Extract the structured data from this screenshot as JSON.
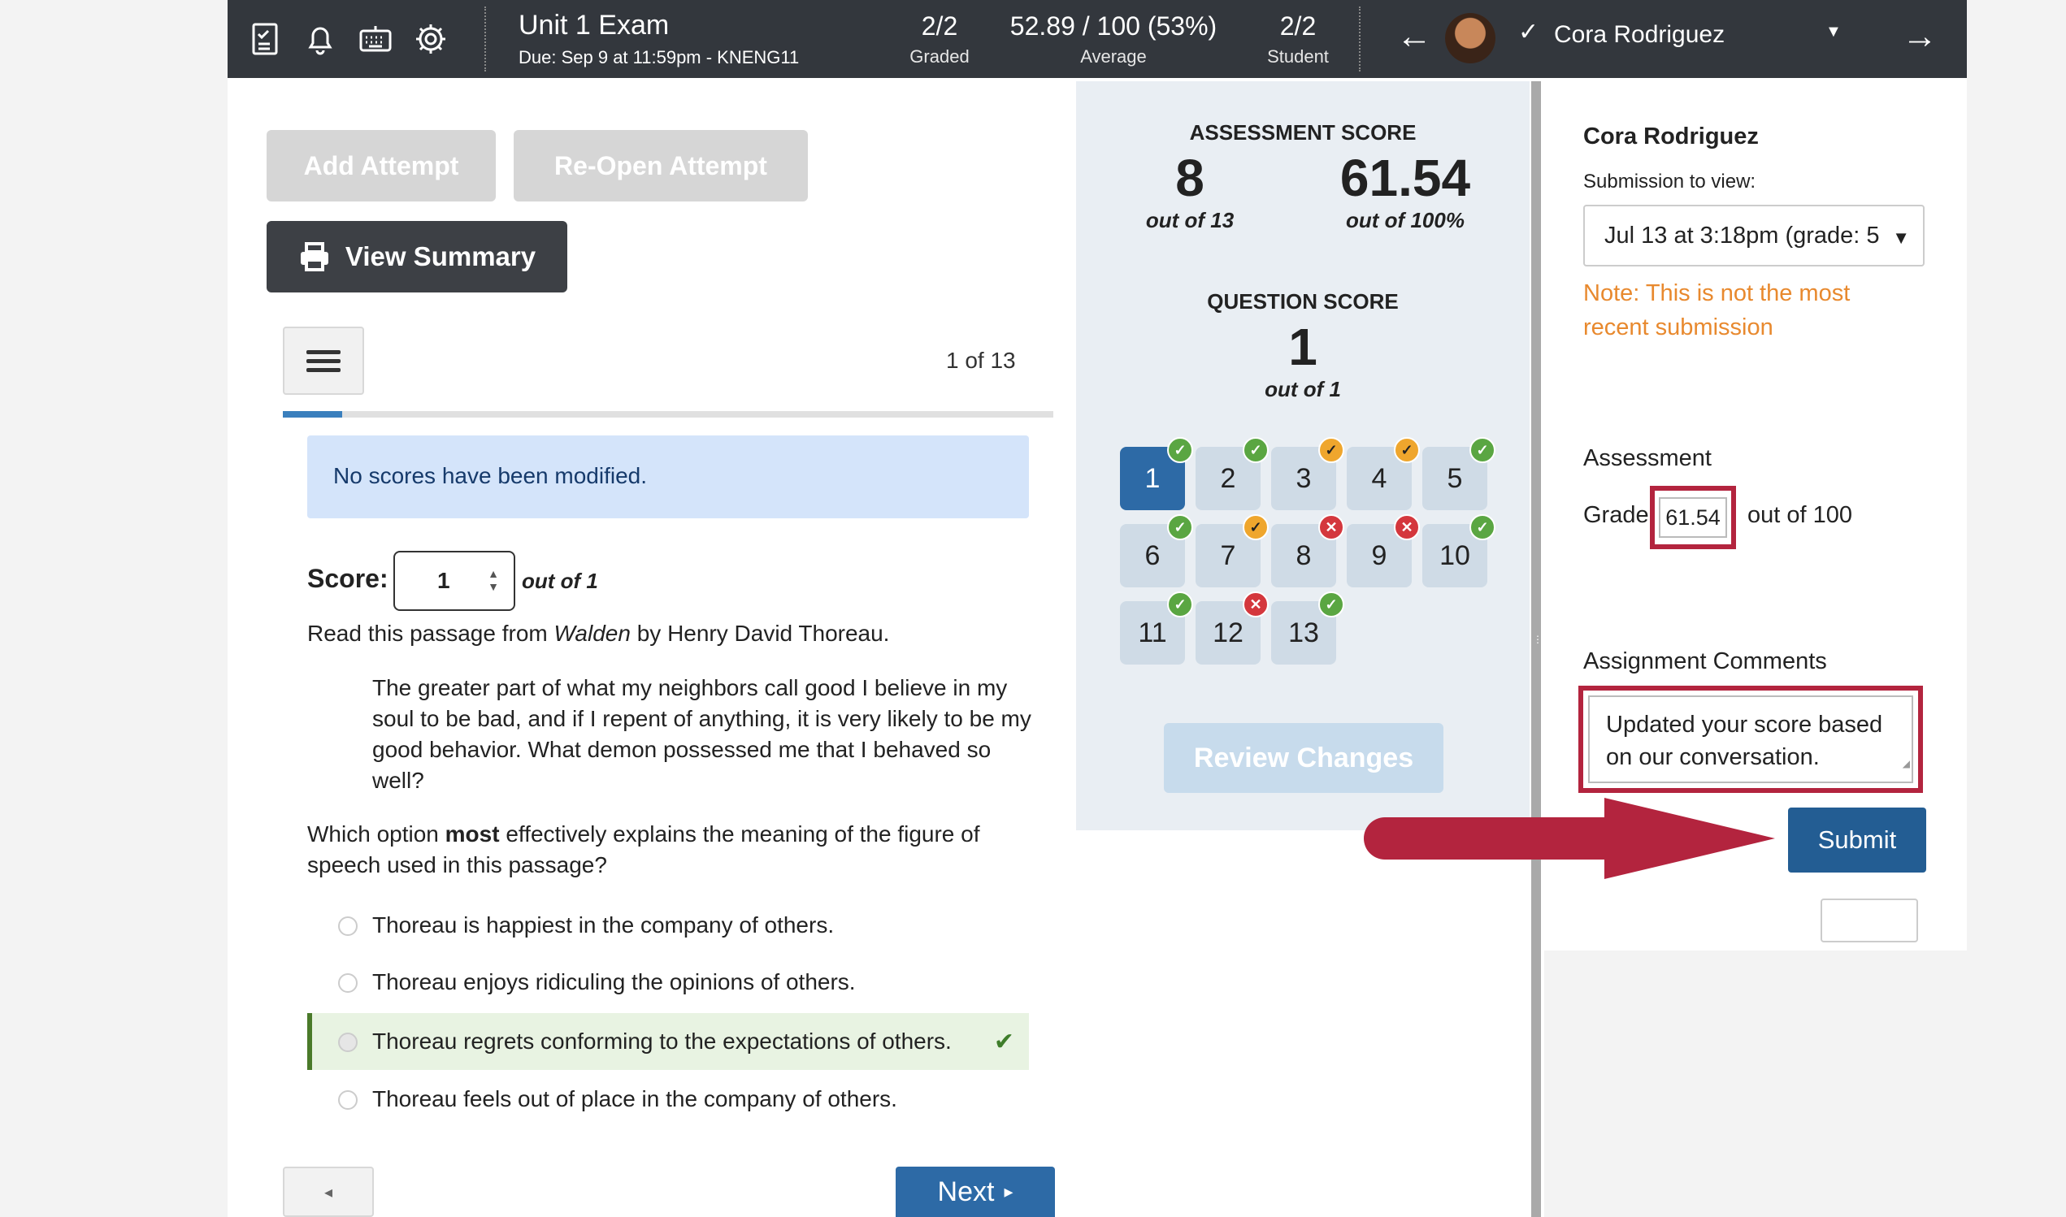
{
  "topbar": {
    "exam_title": "Unit 1 Exam",
    "due": "Due: Sep 9 at 11:59pm - KNENG11",
    "graded_value": "2/2",
    "graded_label": "Graded",
    "average_value": "52.89 / 100 (53%)",
    "average_label": "Average",
    "student_value": "2/2",
    "student_label": "Student",
    "student_name": "Cora Rodriguez",
    "icons": [
      "checklist-icon",
      "bell-icon",
      "keyboard-icon",
      "gear-icon"
    ]
  },
  "actions": {
    "add_attempt": "Add Attempt",
    "reopen_attempt": "Re-Open Attempt",
    "view_summary": "View Summary"
  },
  "question_nav": {
    "position": "1 of 13",
    "progress_fraction": 0.077
  },
  "info_message": "No scores have been modified.",
  "score": {
    "label": "Score:",
    "value": "1",
    "out_of": "out of 1"
  },
  "question": {
    "intro_prefix": "Read this passage from ",
    "intro_title": "Walden",
    "intro_suffix": " by Henry David Thoreau.",
    "passage": "The greater part of what my neighbors call good I believe in my soul to be bad, and if I repent of anything, it is very likely to be my good behavior. What demon possessed me that I behaved so well?",
    "stem_prefix": "Which option ",
    "stem_bold": "most",
    "stem_suffix": " effectively explains the meaning of the figure of speech used in this passage?",
    "options": [
      {
        "text": "Thoreau is happiest in the company of others.",
        "correct": false
      },
      {
        "text": "Thoreau enjoys ridiculing the opinions of others.",
        "correct": false
      },
      {
        "text": "Thoreau regrets conforming to the expectations of others.",
        "correct": true
      },
      {
        "text": "Thoreau feels out of place in the company of others.",
        "correct": false
      }
    ]
  },
  "footer_nav": {
    "prev": "◂",
    "next": "Next"
  },
  "scores_panel": {
    "assessment_heading": "ASSESSMENT SCORE",
    "points": "8",
    "points_sub": "out of 13",
    "percent": "61.54",
    "percent_sub": "out of 100%",
    "question_heading": "QUESTION SCORE",
    "question_points": "1",
    "question_sub": "out of 1",
    "review_changes": "Review Changes",
    "questions": [
      {
        "n": "1",
        "status": "correct",
        "active": true
      },
      {
        "n": "2",
        "status": "correct"
      },
      {
        "n": "3",
        "status": "partial"
      },
      {
        "n": "4",
        "status": "partial"
      },
      {
        "n": "5",
        "status": "correct"
      },
      {
        "n": "6",
        "status": "correct"
      },
      {
        "n": "7",
        "status": "partial"
      },
      {
        "n": "8",
        "status": "incorrect"
      },
      {
        "n": "9",
        "status": "incorrect"
      },
      {
        "n": "10",
        "status": "correct"
      },
      {
        "n": "11",
        "status": "correct"
      },
      {
        "n": "12",
        "status": "incorrect"
      },
      {
        "n": "13",
        "status": "correct"
      }
    ]
  },
  "right_panel": {
    "student_name": "Cora Rodriguez",
    "submission_label": "Submission to view:",
    "submission_value": "Jul 13 at 3:18pm (grade: 5",
    "note": "Note: This is not the most recent submission",
    "assessment_label": "Assessment",
    "grade_label": "Grade",
    "grade_value": "61.54",
    "grade_out_of": "out of 100",
    "comments_label": "Assignment Comments",
    "comments_value": "Updated your score based on our conversation.",
    "submit": "Submit"
  },
  "colors": {
    "topbar": "#33373d",
    "primary": "#2d6aa6",
    "highlight": "#b3243e",
    "note": "#e8892e",
    "correct": "#5aa642",
    "partial": "#efa62d",
    "incorrect": "#d4373d"
  }
}
